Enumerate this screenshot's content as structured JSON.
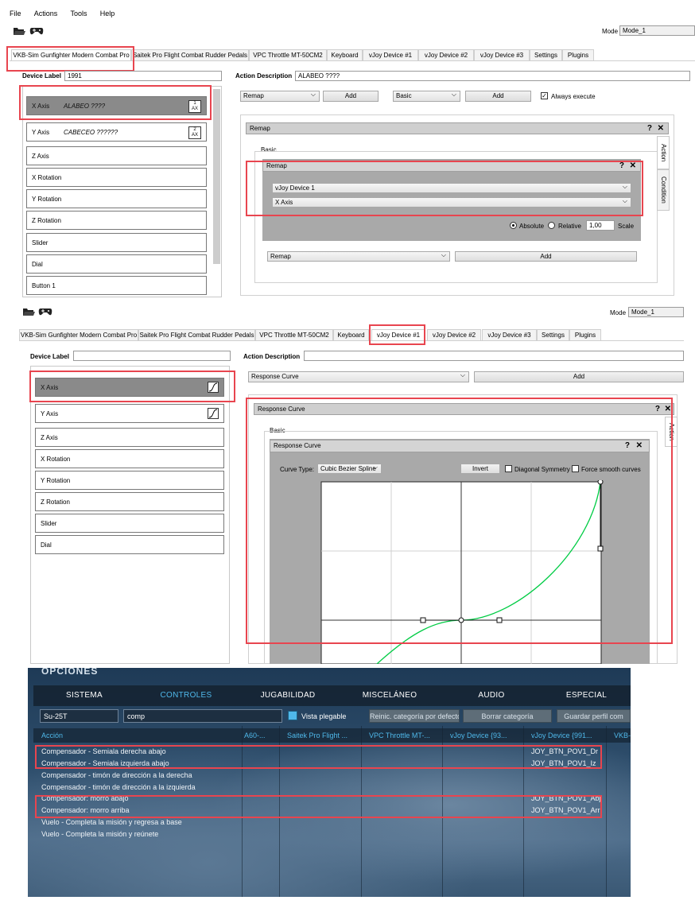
{
  "panel1": {
    "menu": [
      "File",
      "Actions",
      "Tools",
      "Help"
    ],
    "mode_label": "Mode",
    "mode_value": "Mode_1",
    "tabs": [
      "VKB-Sim Gunfighter Modern Combat Pro",
      "Saitek Pro Flight Combat Rudder Pedals",
      "VPC Throttle MT-50CM2",
      "Keyboard",
      "vJoy Device #1",
      "vJoy Device #2",
      "vJoy Device #3",
      "Settings",
      "Plugins"
    ],
    "device_label_caption": "Device Label",
    "device_label_value": "1991",
    "action_description_caption": "Action Description",
    "action_description_value": "ALABEO ????",
    "axes": [
      {
        "label": "X Axis",
        "desc": "ALABEO ????",
        "badge_top": "1",
        "badge_bottom": "AX"
      },
      {
        "label": "Y Axis",
        "desc": "CABECEO ??????",
        "badge_top": "2",
        "badge_bottom": "AX"
      },
      {
        "label": "Z Axis"
      },
      {
        "label": "X Rotation"
      },
      {
        "label": "Y Rotation"
      },
      {
        "label": "Z Rotation"
      },
      {
        "label": "Slider"
      },
      {
        "label": "Dial"
      },
      {
        "label": "Button 1"
      }
    ],
    "combo_action": "Remap",
    "add_label": "Add",
    "combo_condition": "Basic",
    "always_execute": "Always execute",
    "remap_panel_title": "Remap",
    "basic_label": "Basic",
    "side_tabs": [
      "Action",
      "Condition"
    ],
    "inner_title": "Remap",
    "vjoy_device": "vJoy Device 1",
    "vjoy_axis": "X Axis",
    "absolute": "Absolute",
    "relative": "Relative",
    "scale_value": "1,00",
    "scale_label": "Scale",
    "bottom_combo": "Remap",
    "bottom_add": "Add",
    "help_glyph": "?",
    "close_glyph": "✕"
  },
  "panel2": {
    "mode_label": "Mode",
    "mode_value": "Mode_1",
    "tabs": [
      "VKB-Sim Gunfighter Modern Combat Pro",
      "Saitek Pro Flight Combat Rudder Pedals",
      "VPC Throttle MT-50CM2",
      "Keyboard",
      "vJoy Device #1",
      "vJoy Device #2",
      "vJoy Device #3",
      "Settings",
      "Plugins"
    ],
    "device_label_caption": "Device Label",
    "action_description_caption": "Action Description",
    "axes": [
      "X Axis",
      "Y Axis",
      "Z Axis",
      "X Rotation",
      "Y Rotation",
      "Z Rotation",
      "Slider",
      "Dial"
    ],
    "combo_action": "Response Curve",
    "add_label": "Add",
    "outer_title": "Response Curve",
    "basic_label": "Basic",
    "side_tab": "Action",
    "inner_title": "Response Curve",
    "curve_type_label": "Curve Type:",
    "curve_type_value": "Cubic Bezier Spline",
    "invert_label": "Invert",
    "diagonal_symmetry": "Diagonal Symmetry",
    "force_smooth": "Force smooth curves",
    "help_glyph": "?",
    "close_glyph": "✕"
  },
  "panel3": {
    "header_title": "OPCIONES",
    "tabs": [
      "SISTEMA",
      "CONTROLES",
      "JUGABILIDAD",
      "MISCELÁNEO",
      "AUDIO",
      "ESPECIAL"
    ],
    "aircraft": "Su-25T",
    "category": "comp",
    "vista_plegable": "Vista plegable",
    "btn_reset": "Reinic. categoría por defecto",
    "btn_clear": "Borrar categoría",
    "btn_save": "Guardar perfil com",
    "columns": [
      "Acción",
      "A60-...",
      "Saitek Pro Flight ...",
      "VPC Throttle MT-...",
      "vJoy Device {93...",
      "vJoy Device {991...",
      "VKB-"
    ],
    "rows": [
      {
        "action": "Compensador - Semiala derecha abajo",
        "vjoy": "JOY_BTN_POV1_Dr"
      },
      {
        "action": "Compensador - Semiala izquierda abajo",
        "vjoy": "JOY_BTN_POV1_Iz"
      },
      {
        "action": "Compensador - timón de dirección a la derecha",
        "vjoy": ""
      },
      {
        "action": "Compensador - timón de dirección a la izquierda",
        "vjoy": ""
      },
      {
        "action": "Compensador: morro abajo",
        "vjoy": "JOY_BTN_POV1_Abj"
      },
      {
        "action": "Compensador: morro arriba",
        "vjoy": "JOY_BTN_POV1_Arr"
      },
      {
        "action": "Vuelo - Completa la misión y regresa a base",
        "vjoy": ""
      },
      {
        "action": "Vuelo - Completa la misión y reúnete",
        "vjoy": ""
      }
    ]
  },
  "colors": {
    "highlight": "#e8454f",
    "game_accent": "#4fb8ea",
    "curve": "#00cc44"
  }
}
